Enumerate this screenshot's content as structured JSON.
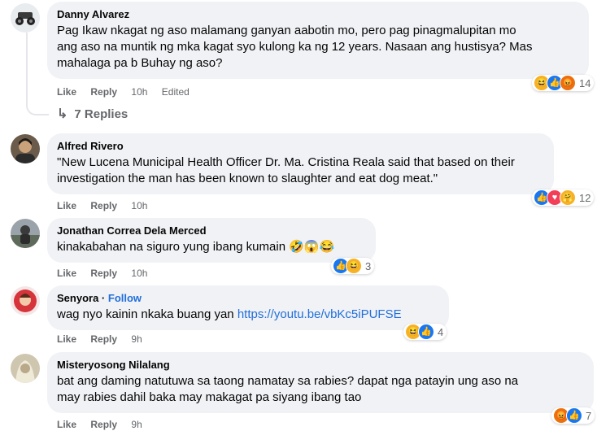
{
  "comments": [
    {
      "author": "Danny Alvarez",
      "text_lines": [
        "Pag Ikaw nkagat ng aso malamang ganyan aabotin mo, pero pag pinagmalupitan mo",
        "ang aso na muntik ng mka kagat syo kulong ka ng 12 years. Nasaan ang hustisya? Mas",
        "mahalaga pa b Buhay ng aso?"
      ],
      "like": "Like",
      "reply": "Reply",
      "time": "10h",
      "edited": "Edited",
      "reactions": [
        "haha",
        "like",
        "angry"
      ],
      "reaction_count": "14",
      "replies_label": "7 Replies"
    },
    {
      "author": "Alfred Rivero",
      "text_lines": [
        "\"New Lucena Municipal Health Officer Dr. Ma. Cristina Reala said that based on their",
        "investigation the man has been known to slaughter and eat dog meat.\""
      ],
      "like": "Like",
      "reply": "Reply",
      "time": "10h",
      "reactions": [
        "like",
        "love",
        "care"
      ],
      "reaction_count": "12"
    },
    {
      "author": "Jonathan Correa Dela Merced",
      "text": "kinakabahan na siguro yung ibang kumain",
      "emojis": "🤣😱😂",
      "like": "Like",
      "reply": "Reply",
      "time": "10h",
      "reactions": [
        "like",
        "haha"
      ],
      "reaction_count": "3"
    },
    {
      "author": "Senyora",
      "follow": "Follow",
      "text": "wag nyo kainin nkaka buang yan ",
      "link": "https://youtu.be/vbKc5iPUFSE",
      "like": "Like",
      "reply": "Reply",
      "time": "9h",
      "reactions": [
        "haha",
        "like"
      ],
      "reaction_count": "4"
    },
    {
      "author": "Misteryosong Nilalang",
      "text_lines": [
        "bat ang daming natutuwa sa taong namatay sa rabies? dapat nga patayin ung aso na",
        "may rabies dahil baka may makagat pa siyang ibang tao"
      ],
      "like": "Like",
      "reply": "Reply",
      "time": "9h",
      "reactions": [
        "angry",
        "like"
      ],
      "reaction_count": "7"
    }
  ]
}
